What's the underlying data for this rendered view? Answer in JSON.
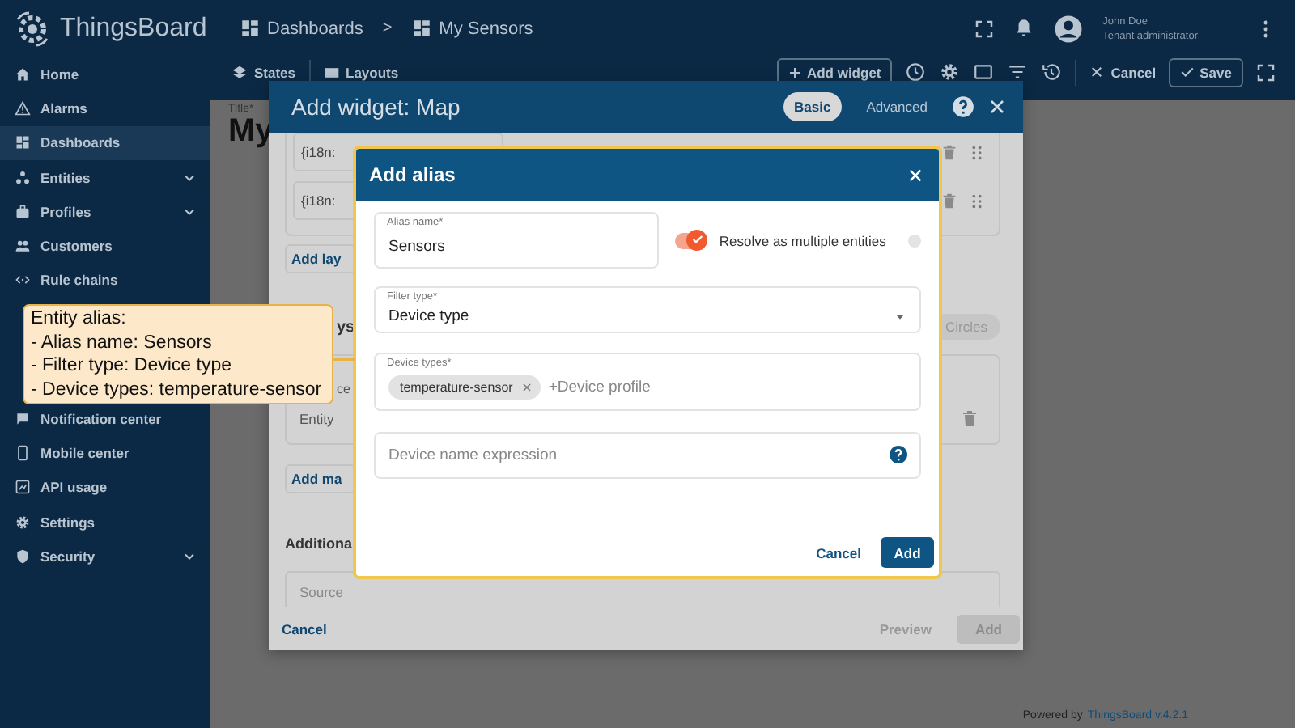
{
  "app": {
    "name": "ThingsBoard"
  },
  "breadcrumb": {
    "items": [
      "Dashboards",
      "My Sensors"
    ],
    "separator": ">"
  },
  "user": {
    "name": "John Doe",
    "role": "Tenant administrator"
  },
  "sidebar": {
    "items": [
      {
        "label": "Home",
        "selected": false,
        "has_submenu": false
      },
      {
        "label": "Alarms",
        "selected": false,
        "has_submenu": false
      },
      {
        "label": "Dashboards",
        "selected": true,
        "has_submenu": false
      },
      {
        "label": "Entities",
        "selected": false,
        "has_submenu": true
      },
      {
        "label": "Profiles",
        "selected": false,
        "has_submenu": true
      },
      {
        "label": "Customers",
        "selected": false,
        "has_submenu": false
      },
      {
        "label": "Rule chains",
        "selected": false,
        "has_submenu": false
      },
      {
        "label": "Notification center",
        "selected": false,
        "has_submenu": false
      },
      {
        "label": "Mobile center",
        "selected": false,
        "has_submenu": false
      },
      {
        "label": "API usage",
        "selected": false,
        "has_submenu": false
      },
      {
        "label": "Settings",
        "selected": false,
        "has_submenu": false
      },
      {
        "label": "Security",
        "selected": false,
        "has_submenu": true
      }
    ]
  },
  "toolbar": {
    "states": "States",
    "layouts": "Layouts",
    "add_widget": "Add widget",
    "cancel": "Cancel",
    "save": "Save"
  },
  "dashboard": {
    "title_label": "Title*",
    "title": "My"
  },
  "widget_dialog": {
    "title": "Add widget: Map",
    "modes": [
      {
        "label": "Basic",
        "selected": true
      },
      {
        "label": "Advanced",
        "selected": false
      }
    ],
    "layer_rows": [
      "{i18n:",
      "{i18n:"
    ],
    "add_layer": "Add lay",
    "keys_heading": "ys",
    "circles_chip": "Circles",
    "source_label": "ce",
    "entity_label": "Entity",
    "add_marker": "Add ma",
    "additional_heading": "Additiona",
    "source_field": "Source",
    "cancel": "Cancel",
    "preview": "Preview",
    "add": {
      "label": "Add",
      "disabled": true
    }
  },
  "alias_dialog": {
    "title": "Add alias",
    "alias_name": {
      "label": "Alias name*",
      "value": "Sensors"
    },
    "resolve_multiple": {
      "label": "Resolve as multiple entities",
      "on": true
    },
    "filter_type": {
      "label": "Filter type*",
      "value": "Device type"
    },
    "device_types": {
      "label": "Device types*",
      "chips": [
        "temperature-sensor"
      ],
      "placeholder": "+Device profile"
    },
    "name_expression": {
      "placeholder": "Device name expression"
    },
    "cancel": "Cancel",
    "add": "Add"
  },
  "callout": {
    "lines": [
      "Entity alias:",
      "- Alias name: Sensors",
      "- Filter type: Device type",
      "- Device types: temperature-sensor"
    ]
  },
  "footer": {
    "powered_by": "Powered by",
    "brand": "ThingsBoard v.4.2.1"
  }
}
